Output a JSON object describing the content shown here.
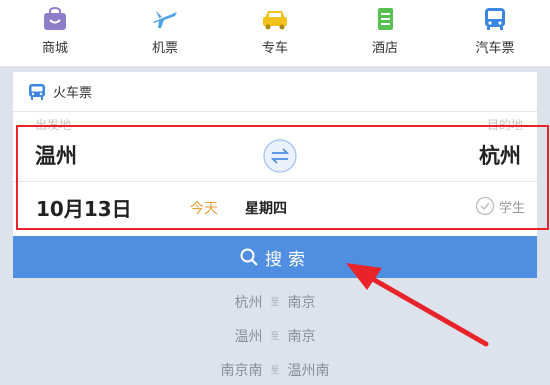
{
  "categories": [
    {
      "label": "商城",
      "icon": "shop-bag-icon"
    },
    {
      "label": "机票",
      "icon": "airplane-icon"
    },
    {
      "label": "专车",
      "icon": "car-icon"
    },
    {
      "label": "酒店",
      "icon": "hotel-icon"
    },
    {
      "label": "汽车票",
      "icon": "bus-icon"
    }
  ],
  "card": {
    "title": "火车票",
    "from_hint": "出发地",
    "to_hint": "目的地",
    "from_city": "温州",
    "to_city": "杭州",
    "date": "10月13日",
    "today": "今天",
    "weekday": "星期四",
    "student_label": "学生"
  },
  "search": {
    "label": "搜索"
  },
  "history": [
    {
      "from": "杭州",
      "sep": "至",
      "to": "南京"
    },
    {
      "from": "温州",
      "sep": "至",
      "to": "南京"
    },
    {
      "from": "南京南",
      "sep": "至",
      "to": "温州南"
    }
  ],
  "colors": {
    "accent_blue": "#4f8ee0",
    "highlight_red": "#e8232a",
    "today_orange": "#e8a13a"
  }
}
